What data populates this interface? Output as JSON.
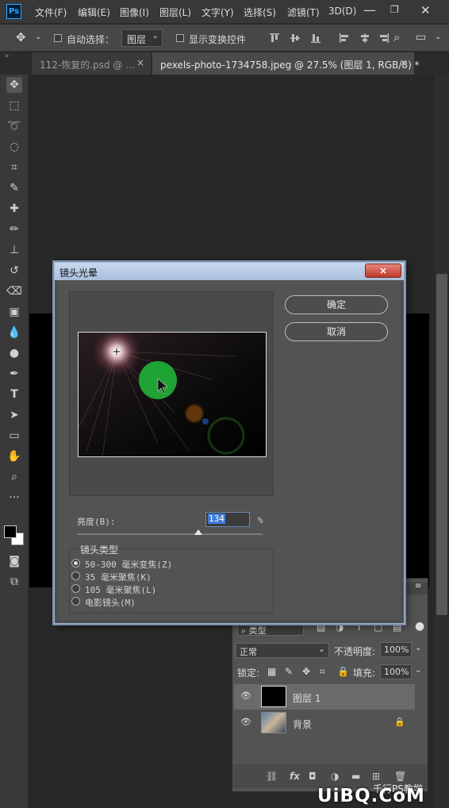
{
  "app": {
    "logo": "Ps"
  },
  "menu": [
    "文件(F)",
    "编辑(E)",
    "图像(I)",
    "图层(L)",
    "文字(Y)",
    "选择(S)",
    "滤镜(T)",
    "3D(D)"
  ],
  "options": {
    "auto_select_label": "自动选择：",
    "auto_select_target": "图层",
    "show_transform_label": "显示变换控件"
  },
  "tabs": [
    {
      "label": "112-恢复的.psd @ ...",
      "close": "×"
    },
    {
      "label": "pexels-photo-1734758.jpeg @ 27.5% (图层 1, RGB/8) *",
      "close": "×"
    }
  ],
  "tools": [
    "move-tool",
    "marquee-tool",
    "lasso-tool",
    "quick-select-tool",
    "crop-tool",
    "eyedropper-tool",
    "healing-tool",
    "brush-tool",
    "stamp-tool",
    "history-brush-tool",
    "eraser-tool",
    "gradient-tool",
    "blur-tool",
    "dodge-tool",
    "pen-tool",
    "type-tool",
    "path-select-tool",
    "rectangle-tool",
    "hand-tool",
    "zoom-tool",
    "more-tools"
  ],
  "dialog": {
    "title": "镜头光晕",
    "close": "×",
    "ok": "确定",
    "cancel": "取消",
    "brightness_label": "亮度(B):",
    "brightness_value": "134",
    "percent": "%",
    "brightness_level": 134,
    "lens_type_label": "镜头类型",
    "lens_options": [
      {
        "label": "50-300 毫米变焦(Z)",
        "checked": true
      },
      {
        "label": "35 毫米聚焦(K)",
        "checked": false
      },
      {
        "label": "105 毫米聚焦(L)",
        "checked": false
      },
      {
        "label": "电影镜头(M)",
        "checked": false
      }
    ]
  },
  "layers": {
    "filter_kind": "类型",
    "blend_mode": "正常",
    "opacity_label": "不透明度:",
    "opacity_value": "100%",
    "lock_label": "锁定:",
    "fill_label": "填充:",
    "fill_value": "100%",
    "items": [
      {
        "name": "图层 1",
        "visible": true,
        "selected": true
      },
      {
        "name": "背景",
        "visible": true,
        "locked": true
      }
    ],
    "fx_label": "fx"
  },
  "watermark": {
    "text": "千行PS教学",
    "site": "UiBQ.CoM"
  }
}
